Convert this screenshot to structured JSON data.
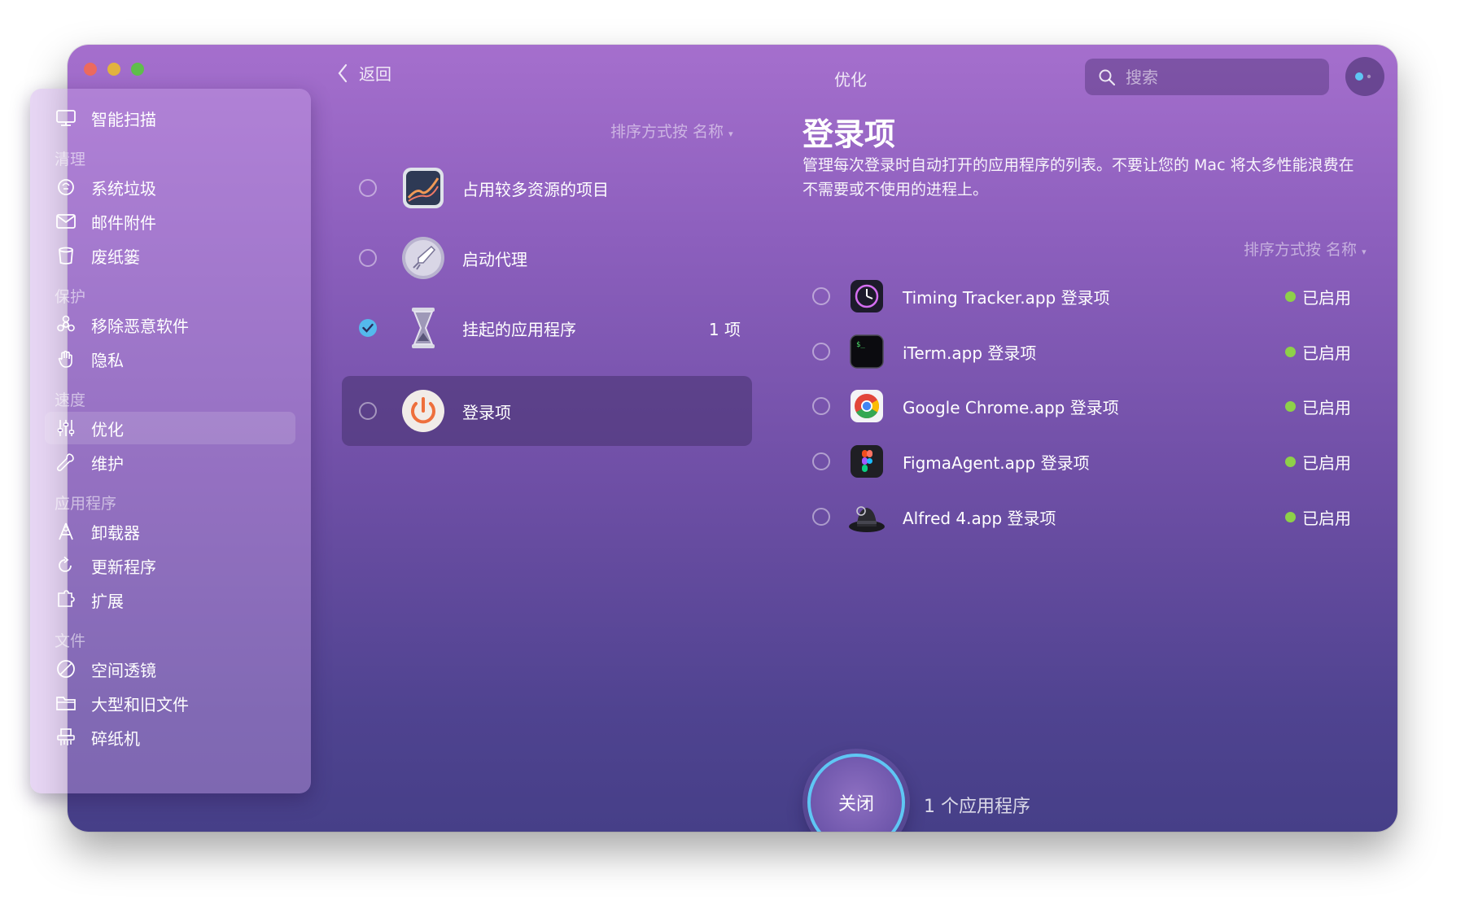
{
  "window": {
    "title": "优化",
    "back_label": "返回",
    "search_placeholder": "搜索"
  },
  "sidebar": {
    "smart_scan": "智能扫描",
    "sections": {
      "cleanup": "清理",
      "protection": "保护",
      "speed": "速度",
      "applications": "应用程序",
      "files": "文件"
    },
    "items": {
      "system_junk": "系统垃圾",
      "mail_attachments": "邮件附件",
      "trash_bins": "废纸篓",
      "malware_removal": "移除恶意软件",
      "privacy": "隐私",
      "optimization": "优化",
      "maintenance": "维护",
      "uninstaller": "卸载器",
      "updater": "更新程序",
      "extensions": "扩展",
      "space_lens": "空间透镜",
      "large_old_files": "大型和旧文件",
      "shredder": "碎纸机"
    },
    "active": "optimization"
  },
  "categories": {
    "sort_label": "排序方式按 名称",
    "items": [
      {
        "label": "占用较多资源的项目",
        "checked": false,
        "count": ""
      },
      {
        "label": "启动代理",
        "checked": false,
        "count": ""
      },
      {
        "label": "挂起的应用程序",
        "checked": true,
        "count": "1 项"
      },
      {
        "label": "登录项",
        "checked": false,
        "count": "",
        "selected": true
      }
    ]
  },
  "detail": {
    "title": "登录项",
    "description": "管理每次登录时自动打开的应用程序的列表。不要让您的 Mac 将太多性能浪费在不需要或不使用的进程上。",
    "sort_label": "排序方式按 名称",
    "status_enabled_color": "#8ed049",
    "apps": [
      {
        "name": "Timing Tracker.app 登录项",
        "status": "已启用",
        "icon": "timing-icon"
      },
      {
        "name": "iTerm.app 登录项",
        "status": "已启用",
        "icon": "iterm-icon"
      },
      {
        "name": "Google Chrome.app 登录项",
        "status": "已启用",
        "icon": "chrome-icon"
      },
      {
        "name": "FigmaAgent.app 登录项",
        "status": "已启用",
        "icon": "figma-icon"
      },
      {
        "name": "Alfred 4.app 登录项",
        "status": "已启用",
        "icon": "alfred-icon"
      }
    ]
  },
  "action": {
    "button_label": "关闭",
    "caption": "1 个应用程序",
    "ring_color": "#5fc6f4"
  }
}
